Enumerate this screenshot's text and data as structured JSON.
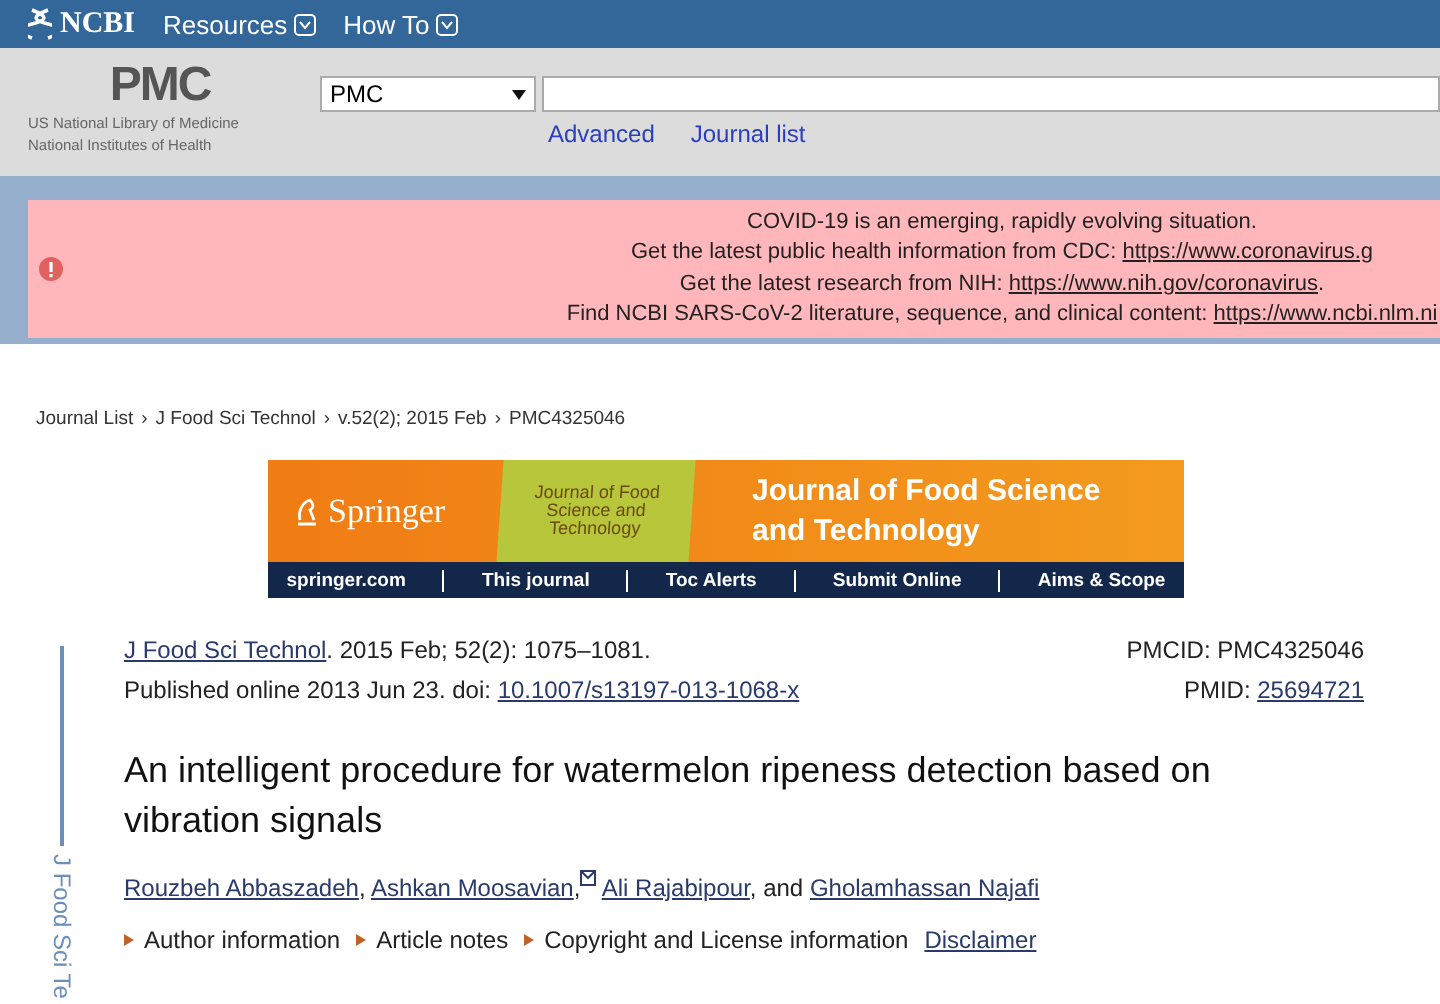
{
  "top_bar": {
    "logo": "NCBI",
    "menus": [
      {
        "label": "Resources"
      },
      {
        "label": "How To"
      }
    ]
  },
  "header": {
    "logo": "PMC",
    "org_lines": [
      "US National Library of Medicine",
      "National Institutes of Health"
    ],
    "database_select": "PMC",
    "links": [
      "Advanced",
      "Journal list"
    ]
  },
  "alert": {
    "lines": [
      {
        "text": "COVID-19 is an emerging, rapidly evolving situation."
      },
      {
        "text": "Get the latest public health information from CDC: ",
        "link": "https://www.coronavirus.g"
      },
      {
        "text": "Get the latest research from NIH: ",
        "link": "https://www.nih.gov/coronavirus",
        "tail": "."
      },
      {
        "text": "Find NCBI SARS-CoV-2 literature, sequence, and clinical content: ",
        "link": "https://www.ncbi.nlm.ni"
      }
    ]
  },
  "breadcrumb_separator": "›",
  "breadcrumb": [
    "Journal List",
    "J Food Sci Technol",
    "v.52(2); 2015 Feb",
    "PMC4325046"
  ],
  "journal_banner": {
    "publisher": "Springer",
    "cover_title": "Journal of Food Science and Technology",
    "title_lines": [
      "Journal of Food Science",
      "and Technology"
    ],
    "links": [
      "springer.com",
      "This journal",
      "Toc Alerts",
      "Submit Online",
      "Aims & Scope"
    ]
  },
  "side_label": "J Food Sci Te",
  "citation": {
    "journal": "J Food Sci Technol",
    "details": ". 2015 Feb; 52(2): 1075–1081.",
    "published": "Published online 2013 Jun 23. doi: ",
    "doi": "10.1007/s13197-013-1068-x",
    "pmcid": "PMCID: PMC4325046",
    "pmid_label": "PMID: ",
    "pmid": "25694721"
  },
  "title": "An intelligent procedure for watermelon ripeness detection based on vibration signals",
  "authors": [
    {
      "name": "Rouzbeh Abbaszadeh",
      "mail": false,
      "after": ","
    },
    {
      "name": "Ashkan Moosavian",
      "mail": true,
      "after": ","
    },
    {
      "name": "Ali Rajabipour",
      "mail": false,
      "after": ", and"
    },
    {
      "name": "Gholamhassan Najafi",
      "mail": false
    }
  ],
  "sections": [
    {
      "label": "Author information"
    },
    {
      "label": "Article notes"
    },
    {
      "label": "Copyright and License information"
    }
  ],
  "disclaimer": "Disclaimer"
}
